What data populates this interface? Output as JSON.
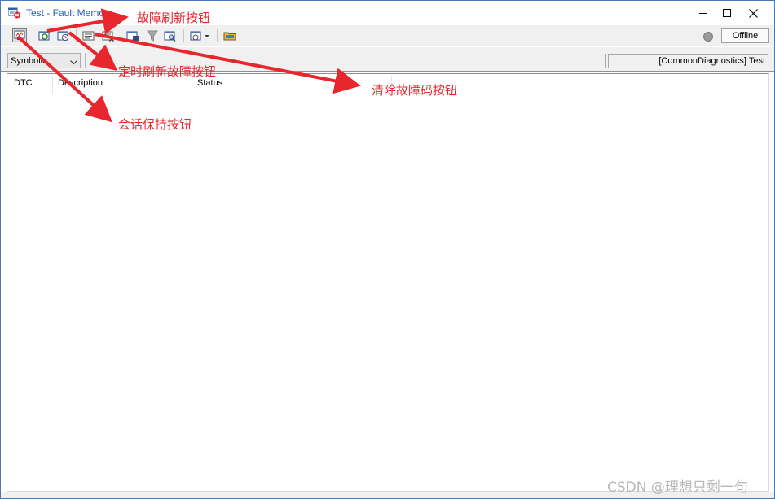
{
  "window": {
    "title": "Test - Fault Memory"
  },
  "toolbar": {
    "buttons": [
      {
        "name": "session-keep-button",
        "icon": "session-icon"
      },
      {
        "name": "refresh-fault-button",
        "icon": "refresh-icon"
      },
      {
        "name": "timed-refresh-button",
        "icon": "timed-refresh-icon"
      },
      {
        "name": "details-button",
        "icon": "list-icon"
      },
      {
        "name": "clear-dtc-button",
        "icon": "clear-icon"
      },
      {
        "name": "export-button",
        "icon": "export-icon"
      },
      {
        "name": "filter-button",
        "icon": "filter-icon"
      },
      {
        "name": "search-button",
        "icon": "search-icon"
      },
      {
        "name": "options-dropdown-button",
        "icon": "options-icon"
      },
      {
        "name": "open-folder-button",
        "icon": "folder-icon"
      }
    ],
    "connection_status": "Offline"
  },
  "filterbar": {
    "display_mode": "Symbolic",
    "context_label": "[CommonDiagnostics] Test"
  },
  "table": {
    "columns": [
      "DTC",
      "Description",
      "Status"
    ],
    "rows": []
  },
  "annotations": {
    "refresh": "故障刷新按钮",
    "timed_refresh": "定时刷新故障按钮",
    "clear": "清除故障码按钮",
    "session": "会话保持按钮"
  },
  "watermark": "CSDN @理想只剩一句",
  "colors": {
    "title_text": "#2a5fb4",
    "annotation": "#e8262d"
  }
}
